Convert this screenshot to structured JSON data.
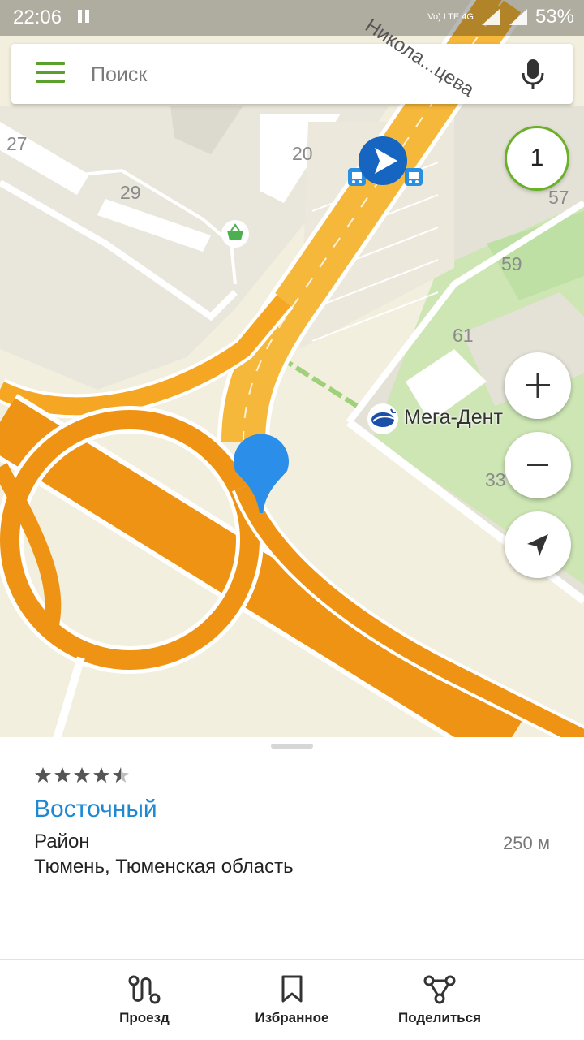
{
  "status_bar": {
    "time": "22:06",
    "network": "Vo) LTE 4G",
    "battery": "53%"
  },
  "search": {
    "placeholder": "Поиск"
  },
  "map": {
    "building_numbers": [
      "27",
      "29",
      "20",
      "57",
      "59",
      "61",
      "33"
    ],
    "street_name": "Никола...цева",
    "poi_name": "Мега-Дент",
    "counter": "1",
    "zoom_in_label": "+",
    "zoom_out_label": "−"
  },
  "place": {
    "rating": 4.5,
    "name": "Восточный",
    "kind": "Район",
    "address": "Тюмень, Тюменская область",
    "distance": "250 м"
  },
  "nav": {
    "route": "Проезд",
    "favorites": "Избранное",
    "share": "Поделиться"
  },
  "colors": {
    "accent": "#1e88d2",
    "menu": "#5aa02c",
    "road": "#ee9314",
    "pin": "#2b8ee8"
  }
}
